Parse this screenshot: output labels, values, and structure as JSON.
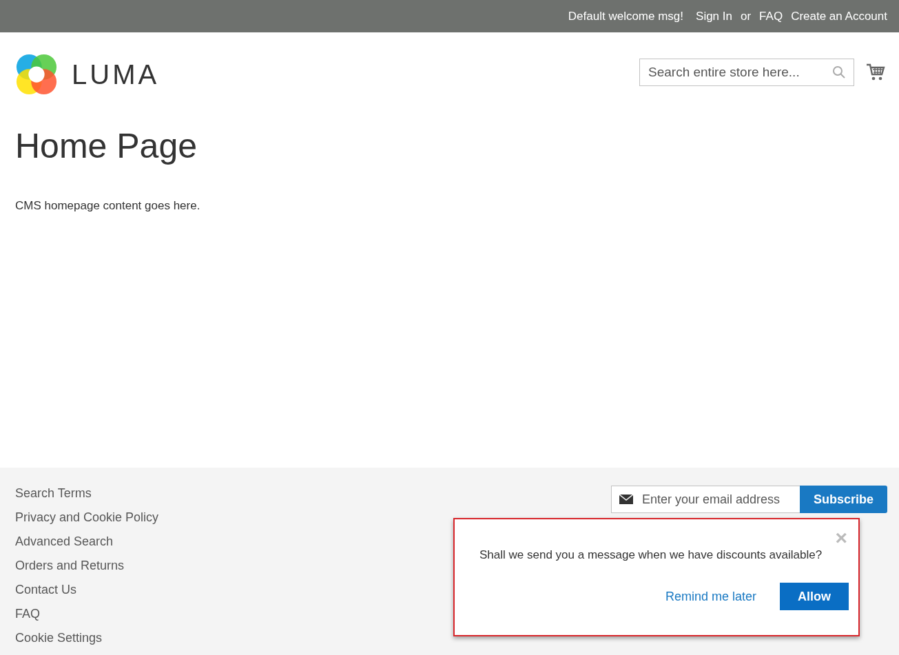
{
  "top_bar": {
    "welcome": "Default welcome msg!",
    "sign_in": "Sign In",
    "separator": "or",
    "links": [
      "FAQ",
      "Create an Account"
    ]
  },
  "header": {
    "logo_text": "LUMA",
    "search": {
      "placeholder": "Search entire store here..."
    }
  },
  "page": {
    "title": "Home Page",
    "content": "CMS homepage content goes here."
  },
  "footer": {
    "links": [
      "Search Terms",
      "Privacy and Cookie Policy",
      "Advanced Search",
      "Orders and Returns",
      "Contact Us",
      "FAQ",
      "Cookie Settings"
    ],
    "newsletter": {
      "placeholder": "Enter your email address",
      "button": "Subscribe"
    }
  },
  "popup": {
    "message": "Shall we send you a message when we have discounts available?",
    "close": "×",
    "secondary_button": "Remind me later",
    "primary_button": "Allow"
  }
}
